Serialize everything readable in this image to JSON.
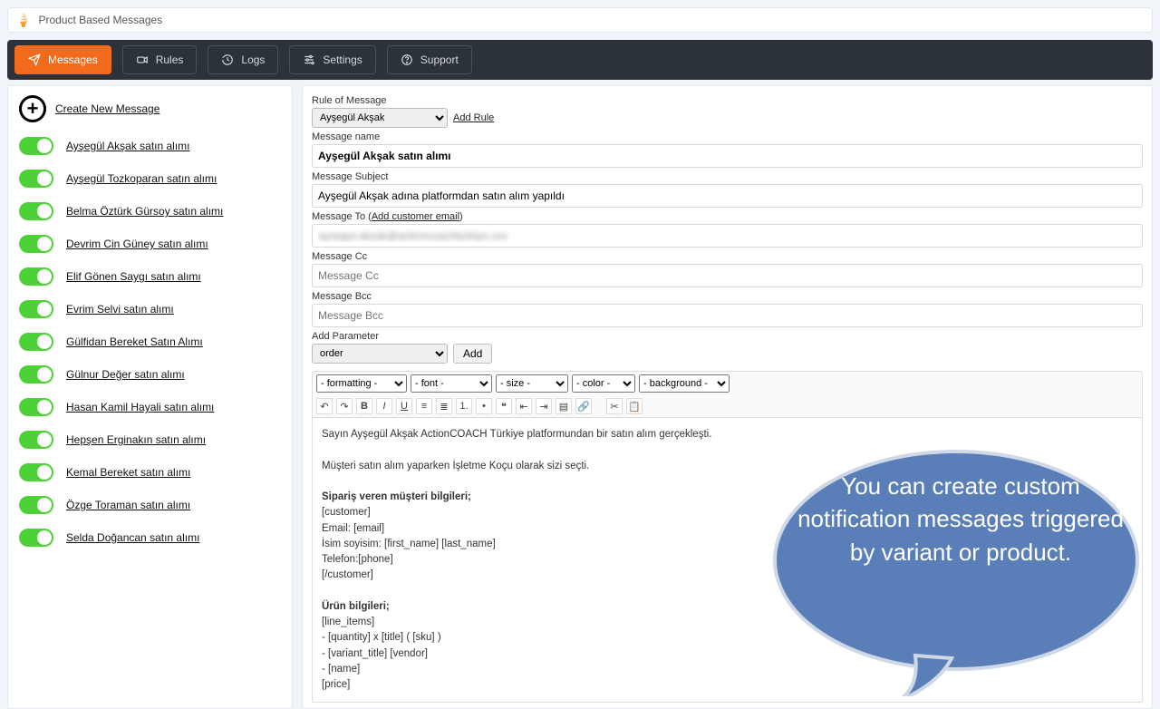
{
  "app": {
    "title": "Product Based Messages"
  },
  "nav": {
    "messages": "Messages",
    "rules": "Rules",
    "logs": "Logs",
    "settings": "Settings",
    "support": "Support"
  },
  "sidebar": {
    "create": "Create New Message",
    "items": [
      {
        "label": "Ayşegül Akşak satın alımı"
      },
      {
        "label": "Ayşegül Tozkoparan satın alımı"
      },
      {
        "label": "Belma Öztürk Gürsoy satın alımı"
      },
      {
        "label": "Devrim Cin Güney satın alımı"
      },
      {
        "label": "Elif Gönen Saygı satın alımı"
      },
      {
        "label": "Evrim Selvi satın alımı"
      },
      {
        "label": "Gülfidan Bereket Satın Alımı"
      },
      {
        "label": "Gülnur Değer satın alımı"
      },
      {
        "label": "Hasan Kamil Hayali satın alımı"
      },
      {
        "label": "Hepşen Erginakın satın alımı"
      },
      {
        "label": "Kemal Bereket satın alımı"
      },
      {
        "label": "Özge Toraman satın alımı"
      },
      {
        "label": "Selda Doğancan satın alımı"
      }
    ]
  },
  "form": {
    "rule_label": "Rule of Message",
    "rule_selected": "Ayşegül Akşak",
    "add_rule": "Add Rule",
    "name_label": "Message name",
    "name_value": "Ayşegül Akşak satın alımı",
    "subject_label": "Message Subject",
    "subject_value": "Ayşegül Akşak adına platformdan satın alım yapıldı",
    "to_label_prefix": "Message To (",
    "to_label_link": "Add customer email",
    "to_label_suffix": ")",
    "to_value": "aysegul.aksak@actioncoachturkiye.xxx",
    "cc_label": "Message Cc",
    "cc_placeholder": "Message Cc",
    "bcc_label": "Message Bcc",
    "bcc_placeholder": "Message Bcc",
    "param_label": "Add Parameter",
    "param_selected": "order",
    "param_add": "Add"
  },
  "toolbar": {
    "formatting": "- formatting -",
    "font": "- font -",
    "size": "- size -",
    "color": "- color -",
    "background": "- background -"
  },
  "editor": {
    "line1": "Sayın Ayşegül Akşak ActionCOACH Türkiye platformundan bir satın alım gerçekleşti.",
    "line2": "Müşteri satın alım yaparken İşletme Koçu olarak sizi seçti.",
    "section1_title": "Sipariş veren müşteri bilgileri;",
    "s1_l1": "[customer]",
    "s1_l2": "Email: [email]",
    "s1_l3": "İsim soyisim: [first_name] [last_name]",
    "s1_l4": "Telefon:[phone]",
    "s1_l5": "[/customer]",
    "section2_title": "Ürün bilgileri;",
    "s2_l1": "[line_items]",
    "s2_l2": " - [quantity] x [title] ( [sku] )",
    "s2_l3": "  - [variant_title] [vendor]",
    "s2_l4": "  - [name]",
    "s2_l5": "  [price]"
  },
  "callout": {
    "text": "You can create custom notification messages triggered by variant or product."
  }
}
